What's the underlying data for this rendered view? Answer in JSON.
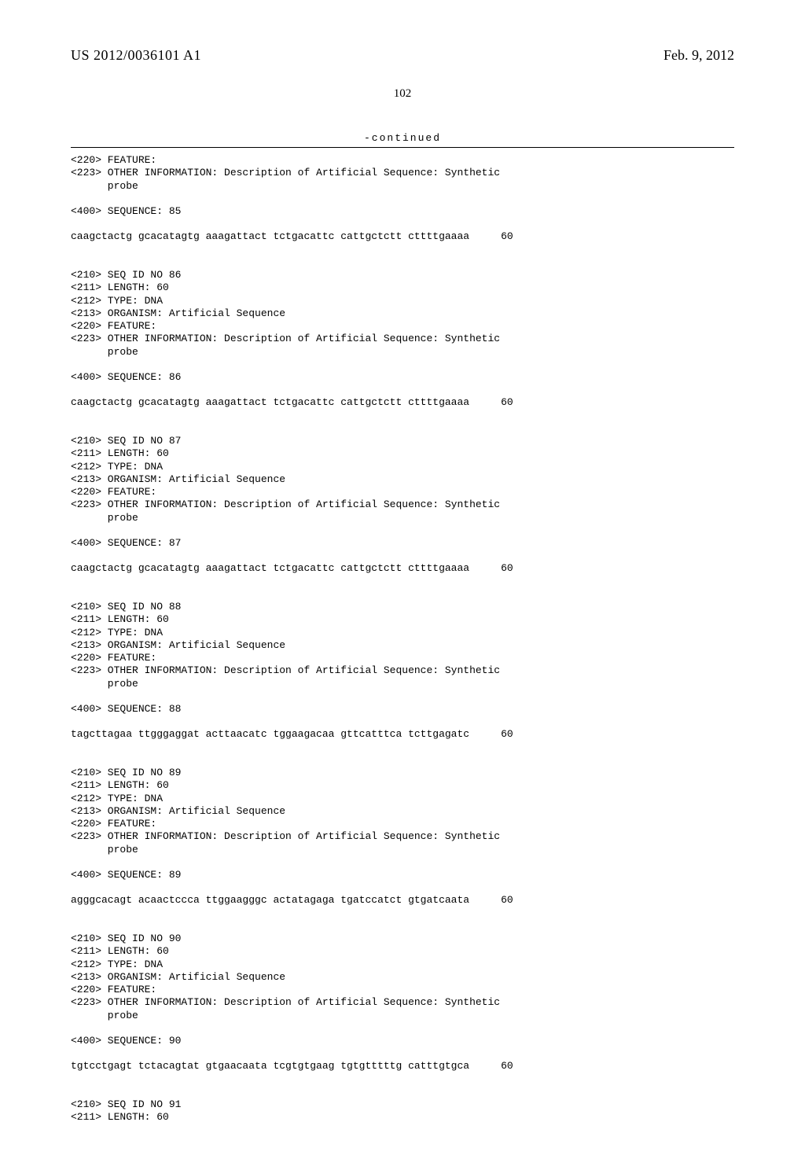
{
  "header": {
    "publication_number": "US 2012/0036101 A1",
    "publication_date": "Feb. 9, 2012"
  },
  "page_number": "102",
  "continued_label": "-continued",
  "entries": [
    {
      "preheader": [
        "<220> FEATURE:",
        "<223> OTHER INFORMATION: Description of Artificial Sequence: Synthetic",
        "      probe"
      ],
      "seq_label": "<400> SEQUENCE: 85",
      "sequence": "caagctactg gcacatagtg aaagattact tctgacattc cattgctctt cttttgaaaa",
      "seq_len": "60"
    },
    {
      "header_lines": [
        "<210> SEQ ID NO 86",
        "<211> LENGTH: 60",
        "<212> TYPE: DNA",
        "<213> ORGANISM: Artificial Sequence",
        "<220> FEATURE:",
        "<223> OTHER INFORMATION: Description of Artificial Sequence: Synthetic",
        "      probe"
      ],
      "seq_label": "<400> SEQUENCE: 86",
      "sequence": "caagctactg gcacatagtg aaagattact tctgacattc cattgctctt cttttgaaaa",
      "seq_len": "60"
    },
    {
      "header_lines": [
        "<210> SEQ ID NO 87",
        "<211> LENGTH: 60",
        "<212> TYPE: DNA",
        "<213> ORGANISM: Artificial Sequence",
        "<220> FEATURE:",
        "<223> OTHER INFORMATION: Description of Artificial Sequence: Synthetic",
        "      probe"
      ],
      "seq_label": "<400> SEQUENCE: 87",
      "sequence": "caagctactg gcacatagtg aaagattact tctgacattc cattgctctt cttttgaaaa",
      "seq_len": "60"
    },
    {
      "header_lines": [
        "<210> SEQ ID NO 88",
        "<211> LENGTH: 60",
        "<212> TYPE: DNA",
        "<213> ORGANISM: Artificial Sequence",
        "<220> FEATURE:",
        "<223> OTHER INFORMATION: Description of Artificial Sequence: Synthetic",
        "      probe"
      ],
      "seq_label": "<400> SEQUENCE: 88",
      "sequence": "tagcttagaa ttgggaggat acttaacatc tggaagacaa gttcatttca tcttgagatc",
      "seq_len": "60"
    },
    {
      "header_lines": [
        "<210> SEQ ID NO 89",
        "<211> LENGTH: 60",
        "<212> TYPE: DNA",
        "<213> ORGANISM: Artificial Sequence",
        "<220> FEATURE:",
        "<223> OTHER INFORMATION: Description of Artificial Sequence: Synthetic",
        "      probe"
      ],
      "seq_label": "<400> SEQUENCE: 89",
      "sequence": "agggcacagt acaactccca ttggaagggc actatagaga tgatccatct gtgatcaata",
      "seq_len": "60"
    },
    {
      "header_lines": [
        "<210> SEQ ID NO 90",
        "<211> LENGTH: 60",
        "<212> TYPE: DNA",
        "<213> ORGANISM: Artificial Sequence",
        "<220> FEATURE:",
        "<223> OTHER INFORMATION: Description of Artificial Sequence: Synthetic",
        "      probe"
      ],
      "seq_label": "<400> SEQUENCE: 90",
      "sequence": "tgtcctgagt tctacagtat gtgaacaata tcgtgtgaag tgtgtttttg catttgtgca",
      "seq_len": "60"
    },
    {
      "header_lines": [
        "<210> SEQ ID NO 91",
        "<211> LENGTH: 60"
      ]
    }
  ]
}
